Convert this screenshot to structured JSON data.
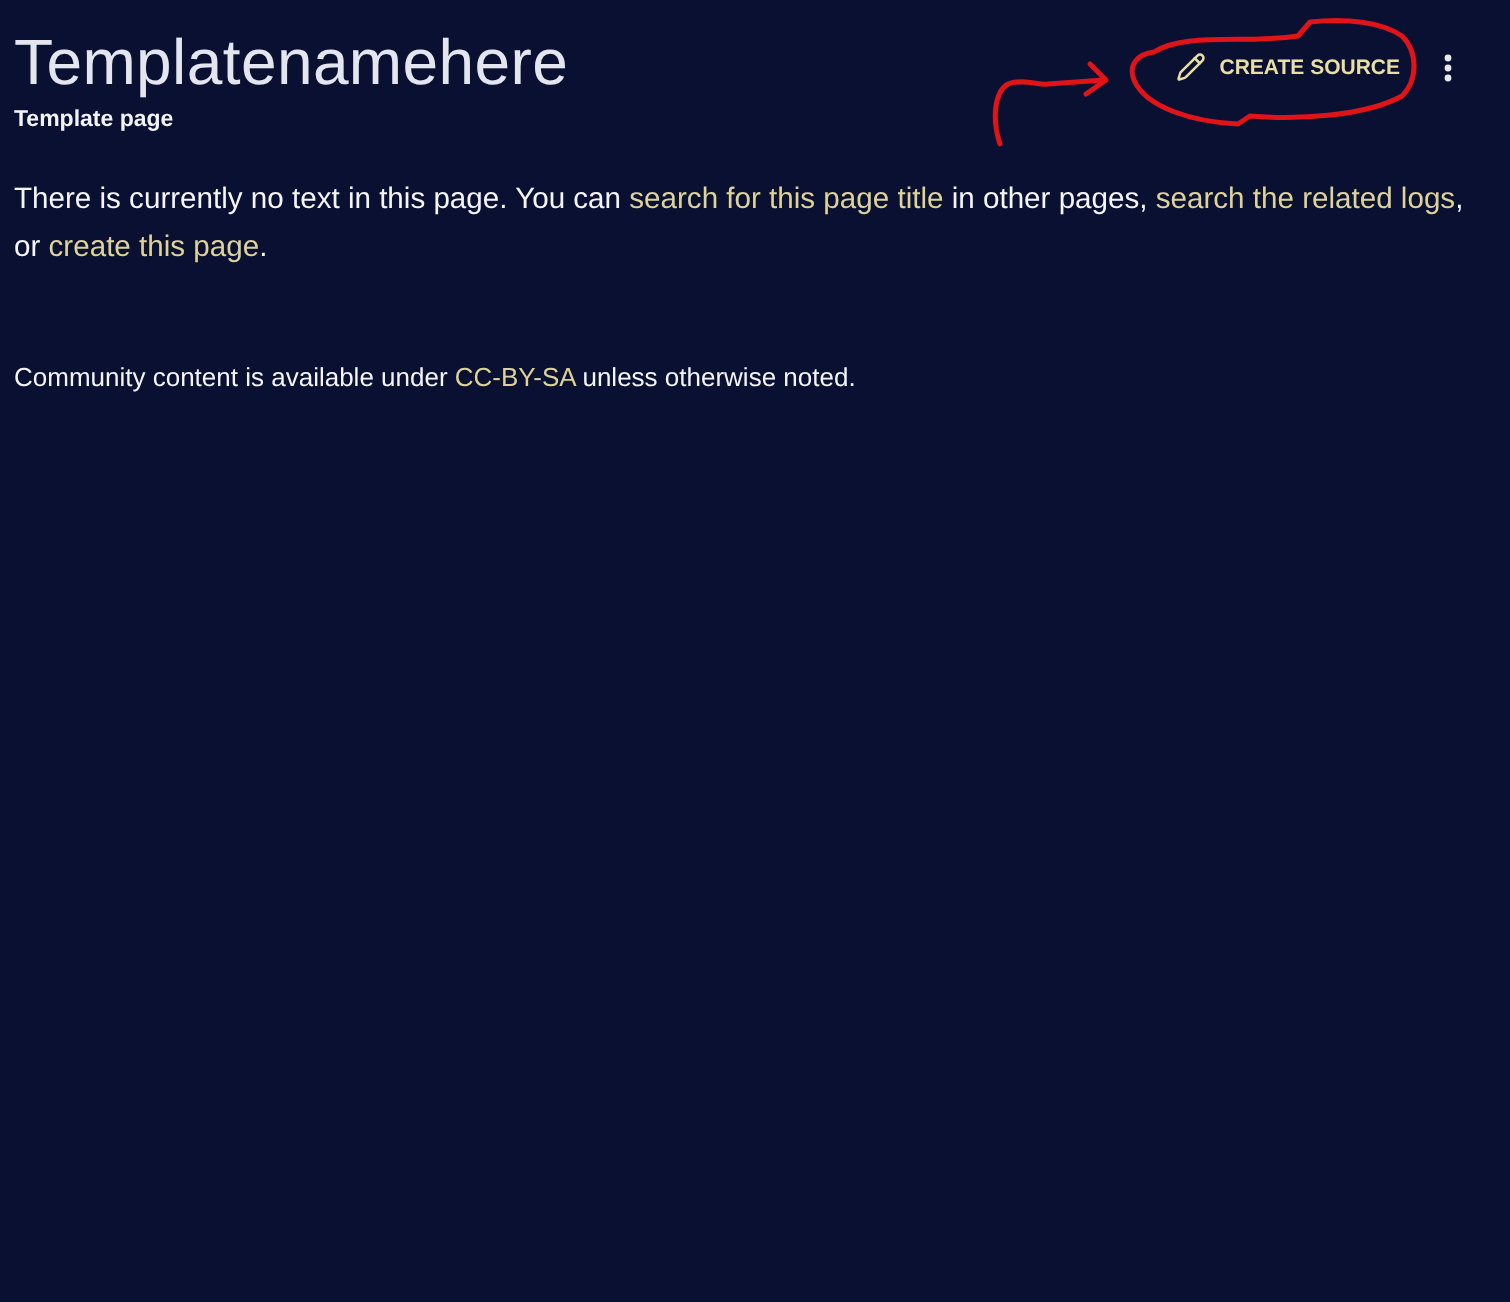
{
  "header": {
    "title": "Templatenamehere",
    "subtitle": "Template page",
    "actions": [
      {
        "kind": "button",
        "label": "CREATE SOURCE"
      },
      {
        "kind": "menu"
      }
    ]
  },
  "notice": [
    {
      "kind": "text",
      "text": "There is currently no text in this page. You can "
    },
    {
      "kind": "link",
      "text": "search for this page title"
    },
    {
      "kind": "text",
      "text": " in other pages, "
    },
    {
      "kind": "link",
      "text": "search the related logs"
    },
    {
      "kind": "text",
      "text": ", or "
    },
    {
      "kind": "link",
      "text": "create this page"
    },
    {
      "kind": "text",
      "text": "."
    }
  ],
  "footer": [
    {
      "kind": "text",
      "text": "Community content is available under "
    },
    {
      "kind": "link",
      "text": "CC-BY-SA"
    },
    {
      "kind": "text",
      "text": " unless otherwise noted."
    }
  ],
  "annotations": [
    {
      "kind": "circle"
    },
    {
      "kind": "arrow"
    }
  ]
}
